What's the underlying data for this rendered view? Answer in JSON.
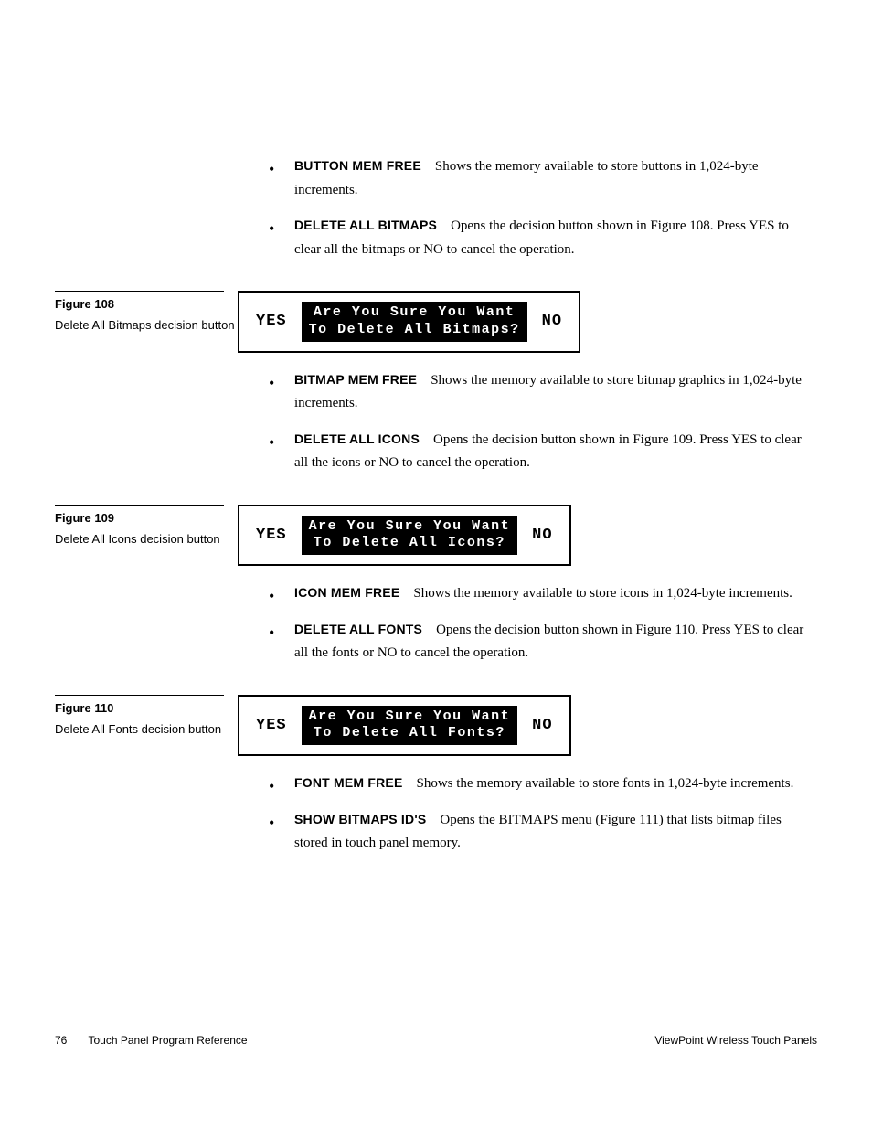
{
  "bullets1": [
    {
      "term": "BUTTON MEM FREE",
      "text": "Shows the memory available to store buttons in 1,024-byte increments."
    },
    {
      "term": "DELETE ALL BITMAPS",
      "text": "Opens the decision button shown in Figure 108. Press YES to clear all the bitmaps or NO to cancel the operation."
    }
  ],
  "fig108": {
    "label": "Figure 108",
    "caption": "Delete All Bitmaps decision button",
    "yes": "YES",
    "msg": "Are You Sure You Want\nTo Delete All Bitmaps?",
    "no": "NO"
  },
  "bullets2": [
    {
      "term": "BITMAP MEM FREE",
      "text": "Shows the memory available to store bitmap graphics in 1,024-byte increments."
    },
    {
      "term": "DELETE ALL ICONS",
      "text": "Opens the decision button shown in Figure 109. Press YES to clear all the icons or NO to cancel the operation."
    }
  ],
  "fig109": {
    "label": "Figure 109",
    "caption": "Delete All Icons decision button",
    "yes": "YES",
    "msg": "Are You Sure You Want\nTo Delete All Icons?",
    "no": "NO"
  },
  "bullets3": [
    {
      "term": "ICON MEM FREE",
      "text": "Shows the memory available to store icons in 1,024-byte increments."
    },
    {
      "term": "DELETE ALL FONTS",
      "text": "Opens the decision button shown in Figure 110. Press YES to clear all the fonts or NO to cancel the operation."
    }
  ],
  "fig110": {
    "label": "Figure 110",
    "caption": "Delete All Fonts decision button",
    "yes": "YES",
    "msg": "Are You Sure You Want\nTo Delete All Fonts?",
    "no": "NO"
  },
  "bullets4": [
    {
      "term": "FONT MEM FREE",
      "text": "Shows the memory available to store fonts in 1,024-byte increments."
    },
    {
      "term": "SHOW BITMAPS ID'S",
      "text": "Opens the BITMAPS menu (Figure 111) that lists bitmap files stored in touch panel memory."
    }
  ],
  "footer": {
    "page": "76",
    "left": "Touch Panel Program Reference",
    "right": "ViewPoint Wireless Touch Panels"
  }
}
